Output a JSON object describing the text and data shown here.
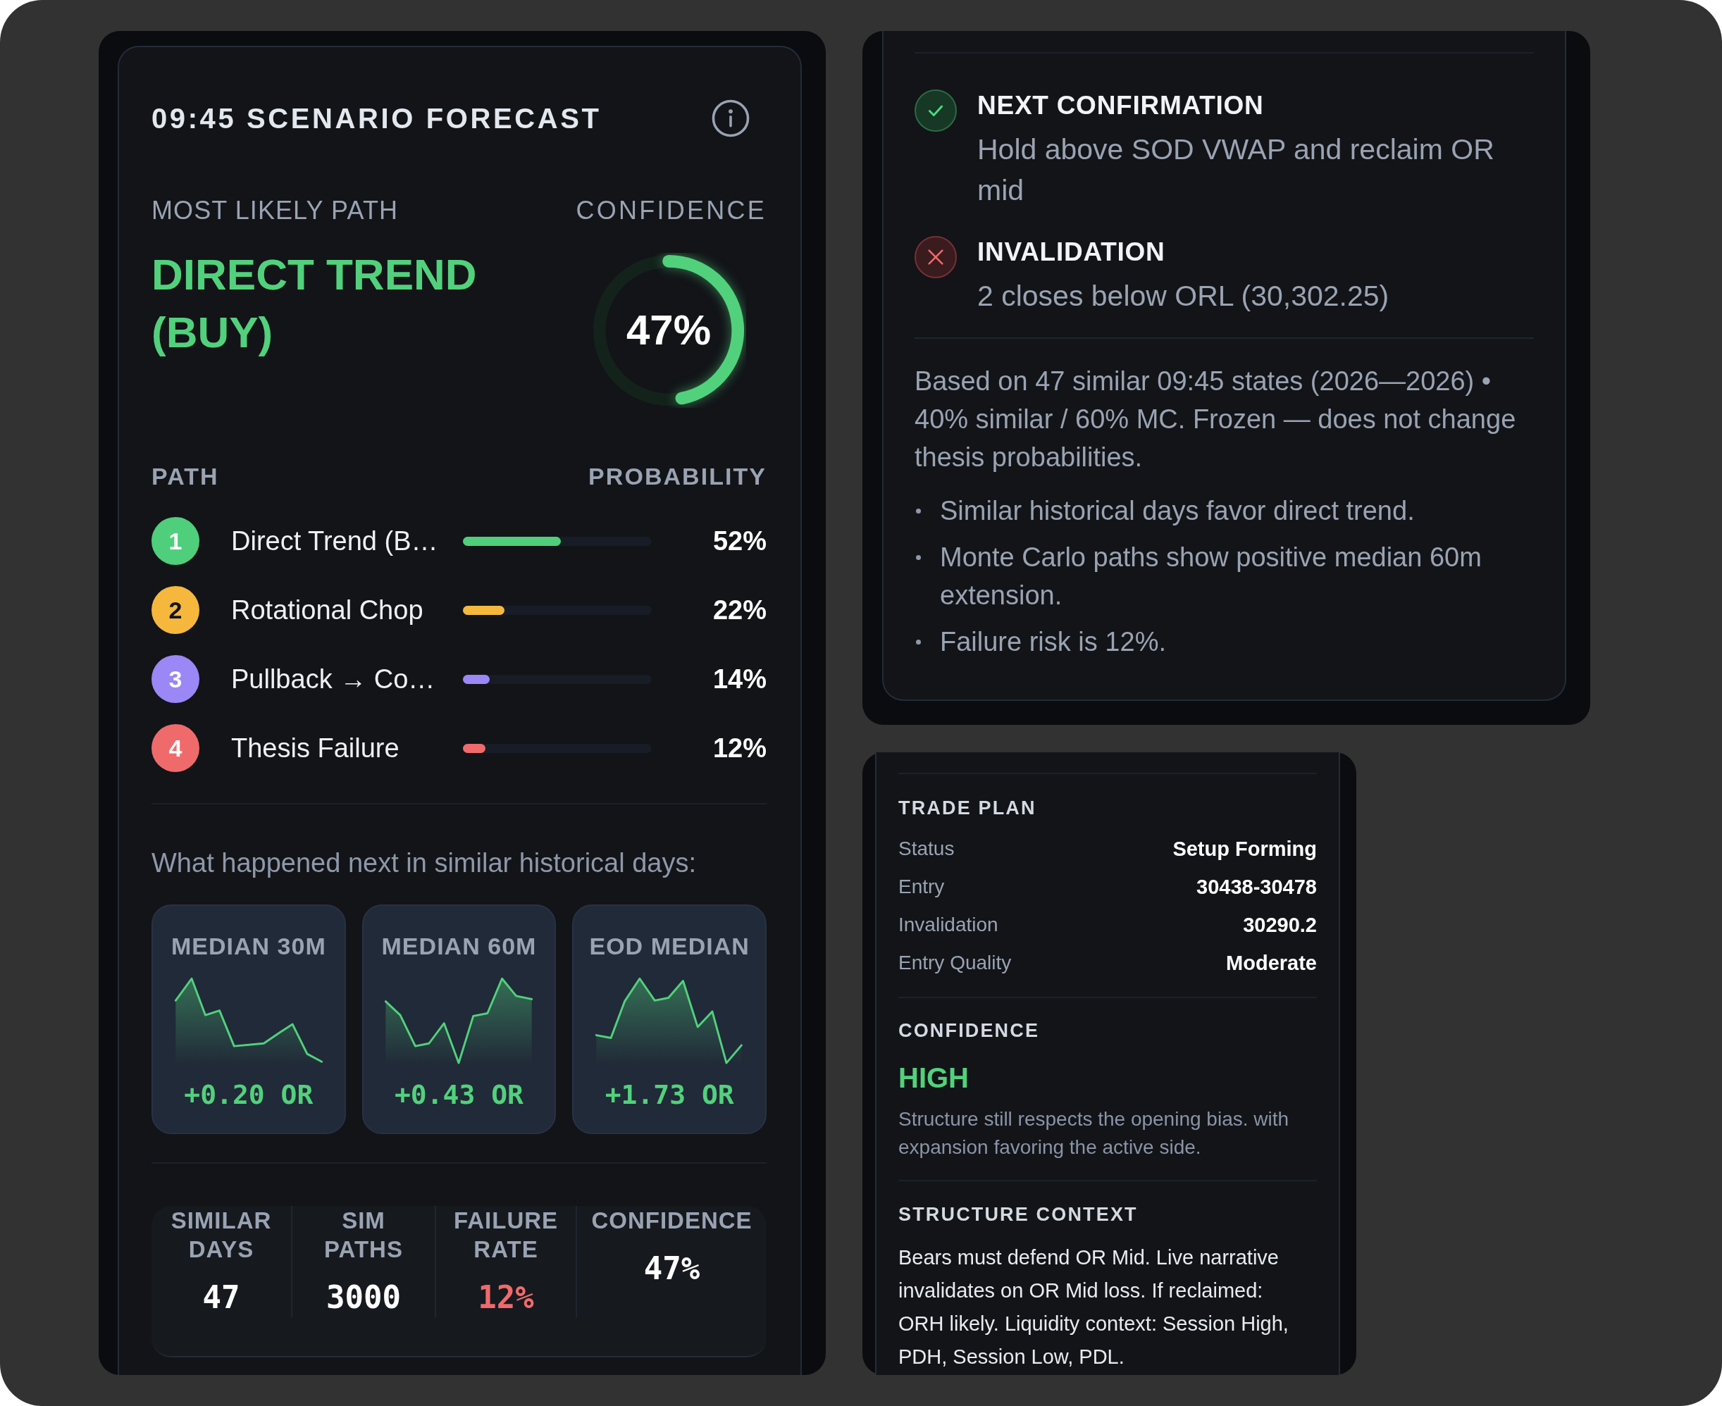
{
  "forecast": {
    "title": "09:45 SCENARIO FORECAST",
    "most_likely_label": "MOST LIKELY PATH",
    "most_likely_path": "DIRECT TREND (BUY)",
    "confidence_label": "CONFIDENCE",
    "confidence": {
      "reading": "47%",
      "level": 0.47
    },
    "path_heading": "PATH",
    "probability_heading": "PROBABILITY",
    "paths": [
      {
        "rank": "1",
        "name": "Direct Trend (B…",
        "level": 0.52,
        "reading": "52%",
        "color": "#4fce7c"
      },
      {
        "rank": "2",
        "name": "Rotational Chop",
        "level": 0.22,
        "reading": "22%",
        "color": "#f5b83d"
      },
      {
        "rank": "3",
        "name": "Pullback → Co…",
        "level": 0.14,
        "reading": "14%",
        "color": "#9b87f5"
      },
      {
        "rank": "4",
        "name": "Thesis Failure",
        "level": 0.12,
        "reading": "12%",
        "color": "#ef6b6b"
      }
    ],
    "history_heading": "What happened next in similar historical days:",
    "medians": [
      {
        "label": "MEDIAN 30M",
        "value": "+0.20 OR"
      },
      {
        "label": "MEDIAN 60M",
        "value": "+0.43 OR"
      },
      {
        "label": "EOD MEDIAN",
        "value": "+1.73 OR"
      }
    ],
    "stats": [
      {
        "label": "SIMILAR DAYS",
        "value": "47",
        "kind": "plain"
      },
      {
        "label": "SIM PATHS",
        "value": "3000",
        "kind": "plain"
      },
      {
        "label": "FAILURE RATE",
        "value": "12%",
        "kind": "alert"
      },
      {
        "label": "CONFIDENCE",
        "value": "47%",
        "kind": "plain"
      }
    ]
  },
  "thesis": {
    "checks": [
      {
        "kind": "confirm",
        "title": "NEXT CONFIRMATION",
        "text": "Hold above SOD VWAP and reclaim OR mid"
      },
      {
        "kind": "invalidate",
        "title": "INVALIDATION",
        "text": "2 closes below ORL (30,302.25)"
      }
    ],
    "basis": "Based on 47 similar 09:45 states (2026—2026) • 40% similar / 60% MC. Frozen — does not change thesis probabilities.",
    "bullets": [
      "Similar historical days favor direct trend.",
      "Monte Carlo paths show positive median 60m extension.",
      "Failure risk is 12%."
    ]
  },
  "trade_plan": {
    "title": "TRADE PLAN",
    "rows": [
      {
        "label": "Status",
        "value": "Setup Forming"
      },
      {
        "label": "Entry",
        "value": "30438-30478"
      },
      {
        "label": "Invalidation",
        "value": "30290.2"
      },
      {
        "label": "Entry Quality",
        "value": "Moderate"
      }
    ],
    "confidence_title": "CONFIDENCE",
    "confidence_value": "HIGH",
    "confidence_note": "Structure still respects the opening bias. with expansion favoring the active side.",
    "context_title": "STRUCTURE CONTEXT",
    "context_text": "Bears must defend OR Mid. Live narrative invalidates on OR Mid loss. If reclaimed: ORH likely. Liquidity context: Session High, PDH, Session Low, PDL."
  }
}
